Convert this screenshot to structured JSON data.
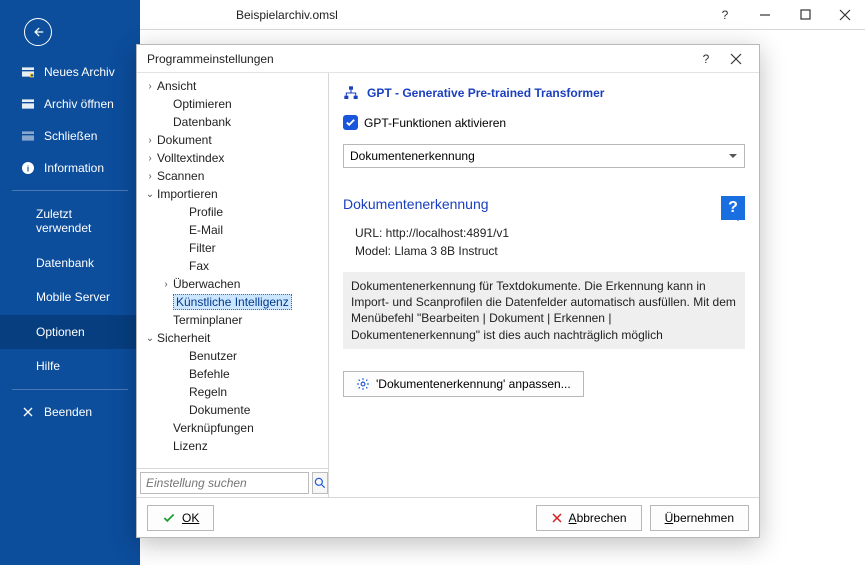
{
  "window": {
    "title": "Beispielarchiv.omsl"
  },
  "sidebar": {
    "items": [
      {
        "label": "Neues Archiv"
      },
      {
        "label": "Archiv öffnen"
      },
      {
        "label": "Schließen"
      },
      {
        "label": "Information"
      }
    ],
    "secondary": [
      {
        "label": "Zuletzt\nverwendet"
      },
      {
        "label": "Datenbank"
      },
      {
        "label": "Mobile Server"
      },
      {
        "label": "Optionen",
        "selected": true
      },
      {
        "label": "Hilfe"
      }
    ],
    "exit": {
      "label": "Beenden"
    }
  },
  "dialog": {
    "title": "Programmeinstellungen",
    "search_placeholder": "Einstellung suchen",
    "ok_label": "OK",
    "cancel_label": "Abbrechen",
    "apply_label": "Übernehmen"
  },
  "tree": [
    {
      "label": "Ansicht",
      "depth": 0,
      "twist": ">"
    },
    {
      "label": "Optimieren",
      "depth": 1
    },
    {
      "label": "Datenbank",
      "depth": 1
    },
    {
      "label": "Dokument",
      "depth": 0,
      "twist": ">"
    },
    {
      "label": "Volltextindex",
      "depth": 0,
      "twist": ">"
    },
    {
      "label": "Scannen",
      "depth": 0,
      "twist": ">"
    },
    {
      "label": "Importieren",
      "depth": 0,
      "twist": "v"
    },
    {
      "label": "Profile",
      "depth": 2
    },
    {
      "label": "E-Mail",
      "depth": 2
    },
    {
      "label": "Filter",
      "depth": 2
    },
    {
      "label": "Fax",
      "depth": 2
    },
    {
      "label": "Überwachen",
      "depth": 1,
      "twist": ">"
    },
    {
      "label": "Künstliche Intelligenz",
      "depth": 1,
      "selected": true
    },
    {
      "label": "Terminplaner",
      "depth": 1
    },
    {
      "label": "Sicherheit",
      "depth": 0,
      "twist": "v"
    },
    {
      "label": "Benutzer",
      "depth": 2
    },
    {
      "label": "Befehle",
      "depth": 2
    },
    {
      "label": "Regeln",
      "depth": 2
    },
    {
      "label": "Dokumente",
      "depth": 2
    },
    {
      "label": "Verknüpfungen",
      "depth": 1
    },
    {
      "label": "Lizenz",
      "depth": 1
    }
  ],
  "pane": {
    "heading": "GPT - Generative Pre-trained Transformer",
    "checkbox_label": "GPT-Funktionen aktivieren",
    "select_value": "Dokumentenerkennung",
    "section_heading": "Dokumentenerkennung",
    "url_label": "URL: http://localhost:4891/v1",
    "model_label": "Model: Llama 3 8B Instruct",
    "description": "Dokumentenerkennung für Textdokumente. Die Erkennung kann in Import- und Scanprofilen die Datenfelder automatisch ausfüllen. Mit dem Menübefehl \"Bearbeiten | Dokument | Erkennen | Dokumentenerkennung\" ist dies auch nachträglich möglich",
    "customize_button": "'Dokumentenerkennung' anpassen..."
  }
}
